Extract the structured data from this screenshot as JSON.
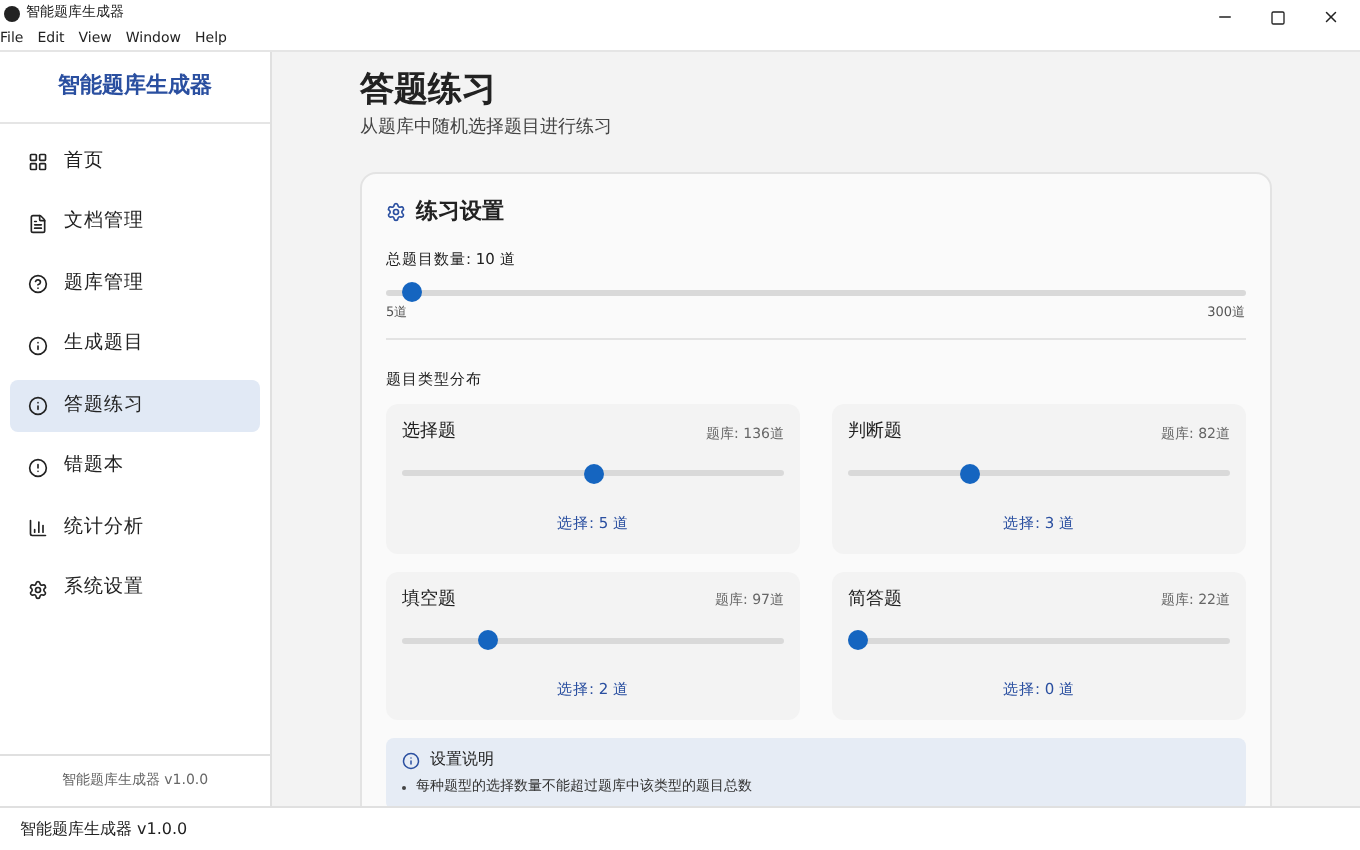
{
  "window": {
    "title": "智能题库生成器"
  },
  "menu": [
    "File",
    "Edit",
    "View",
    "Window",
    "Help"
  ],
  "sidebar": {
    "title": "智能题库生成器",
    "items": [
      {
        "label": "首页",
        "selected": false
      },
      {
        "label": "文档管理",
        "selected": false
      },
      {
        "label": "题库管理",
        "selected": false
      },
      {
        "label": "生成题目",
        "selected": false
      },
      {
        "label": "答题练习",
        "selected": true
      },
      {
        "label": "错题本",
        "selected": false
      },
      {
        "label": "统计分析",
        "selected": false
      },
      {
        "label": "系统设置",
        "selected": false
      }
    ],
    "footer": "智能题库生成器 v1.0.0"
  },
  "page": {
    "title": "答题练习",
    "subtitle": "从题库中随机选择题目进行练习"
  },
  "settings": {
    "title": "练习设置",
    "total_label": "总题目数量: 10 道",
    "total_slider": {
      "level": 0.02
    },
    "min_label": "5道",
    "max_label": "300道",
    "distribution_title": "题目类型分布",
    "types": [
      {
        "name": "选择题",
        "bank": "题库: 136道",
        "level": 0.5,
        "selected": "选择: 5 道"
      },
      {
        "name": "判断题",
        "bank": "题库: 82道",
        "level": 0.31,
        "selected": "选择: 3 道"
      },
      {
        "name": "填空题",
        "bank": "题库: 97道",
        "level": 0.21,
        "selected": "选择: 2 道"
      },
      {
        "name": "简答题",
        "bank": "题库: 22道",
        "level": 0,
        "selected": "选择: 0 道"
      }
    ],
    "info": {
      "title": "设置说明",
      "bullets": [
        "每种题型的选择数量不能超过题库中该类型的题目总数"
      ]
    }
  },
  "status_bar": "智能题库生成器 v1.0.0"
}
